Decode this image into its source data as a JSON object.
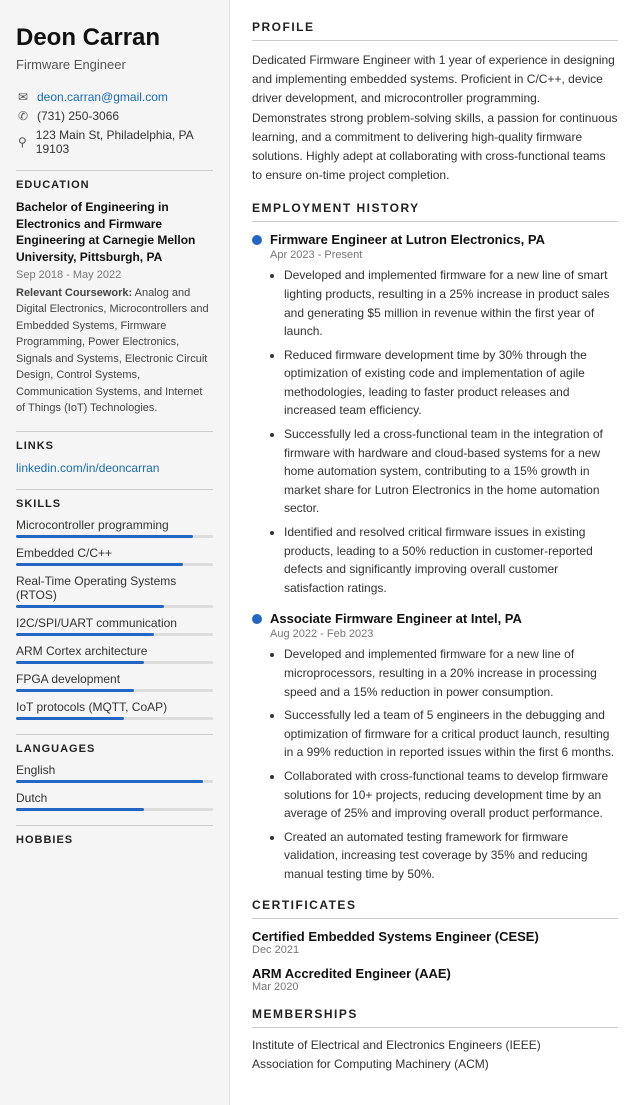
{
  "sidebar": {
    "name": "Deon Carran",
    "job_title": "Firmware Engineer",
    "contact": {
      "email": "deon.carran@gmail.com",
      "phone": "(731) 250-3066",
      "address": "123 Main St, Philadelphia, PA 19103"
    },
    "education_section_label": "EDUCATION",
    "education": {
      "degree": "Bachelor of Engineering in Electronics and Firmware Engineering at Carnegie Mellon University, Pittsburgh, PA",
      "dates": "Sep 2018 - May 2022",
      "coursework_label": "Relevant Coursework:",
      "coursework": "Analog and Digital Electronics, Microcontrollers and Embedded Systems, Firmware Programming, Power Electronics, Signals and Systems, Electronic Circuit Design, Control Systems, Communication Systems, and Internet of Things (IoT) Technologies."
    },
    "links_section_label": "LINKS",
    "links": [
      {
        "label": "linkedin.com/in/deoncarran",
        "url": "#"
      }
    ],
    "skills_section_label": "SKILLS",
    "skills": [
      {
        "label": "Microcontroller programming",
        "pct": 90
      },
      {
        "label": "Embedded C/C++",
        "pct": 85
      },
      {
        "label": "Real-Time Operating Systems (RTOS)",
        "pct": 75
      },
      {
        "label": "I2C/SPI/UART communication",
        "pct": 70
      },
      {
        "label": "ARM Cortex architecture",
        "pct": 65
      },
      {
        "label": "FPGA development",
        "pct": 60
      },
      {
        "label": "IoT protocols (MQTT, CoAP)",
        "pct": 55
      }
    ],
    "languages_section_label": "LANGUAGES",
    "languages": [
      {
        "label": "English",
        "pct": 95
      },
      {
        "label": "Dutch",
        "pct": 65
      }
    ],
    "hobbies_section_label": "HOBBIES"
  },
  "main": {
    "profile_section_label": "PROFILE",
    "profile_text": "Dedicated Firmware Engineer with 1 year of experience in designing and implementing embedded systems. Proficient in C/C++, device driver development, and microcontroller programming. Demonstrates strong problem-solving skills, a passion for continuous learning, and a commitment to delivering high-quality firmware solutions. Highly adept at collaborating with cross-functional teams to ensure on-time project completion.",
    "employment_section_label": "EMPLOYMENT HISTORY",
    "jobs": [
      {
        "title": "Firmware Engineer at Lutron Electronics, PA",
        "dates": "Apr 2023 - Present",
        "bullets": [
          "Developed and implemented firmware for a new line of smart lighting products, resulting in a 25% increase in product sales and generating $5 million in revenue within the first year of launch.",
          "Reduced firmware development time by 30% through the optimization of existing code and implementation of agile methodologies, leading to faster product releases and increased team efficiency.",
          "Successfully led a cross-functional team in the integration of firmware with hardware and cloud-based systems for a new home automation system, contributing to a 15% growth in market share for Lutron Electronics in the home automation sector.",
          "Identified and resolved critical firmware issues in existing products, leading to a 50% reduction in customer-reported defects and significantly improving overall customer satisfaction ratings."
        ]
      },
      {
        "title": "Associate Firmware Engineer at Intel, PA",
        "dates": "Aug 2022 - Feb 2023",
        "bullets": [
          "Developed and implemented firmware for a new line of microprocessors, resulting in a 20% increase in processing speed and a 15% reduction in power consumption.",
          "Successfully led a team of 5 engineers in the debugging and optimization of firmware for a critical product launch, resulting in a 99% reduction in reported issues within the first 6 months.",
          "Collaborated with cross-functional teams to develop firmware solutions for 10+ projects, reducing development time by an average of 25% and improving overall product performance.",
          "Created an automated testing framework for firmware validation, increasing test coverage by 35% and reducing manual testing time by 50%."
        ]
      }
    ],
    "certificates_section_label": "CERTIFICATES",
    "certificates": [
      {
        "name": "Certified Embedded Systems Engineer (CESE)",
        "date": "Dec 2021"
      },
      {
        "name": "ARM Accredited Engineer (AAE)",
        "date": "Mar 2020"
      }
    ],
    "memberships_section_label": "MEMBERSHIPS",
    "memberships": [
      "Institute of Electrical and Electronics Engineers (IEEE)",
      "Association for Computing Machinery (ACM)"
    ]
  }
}
